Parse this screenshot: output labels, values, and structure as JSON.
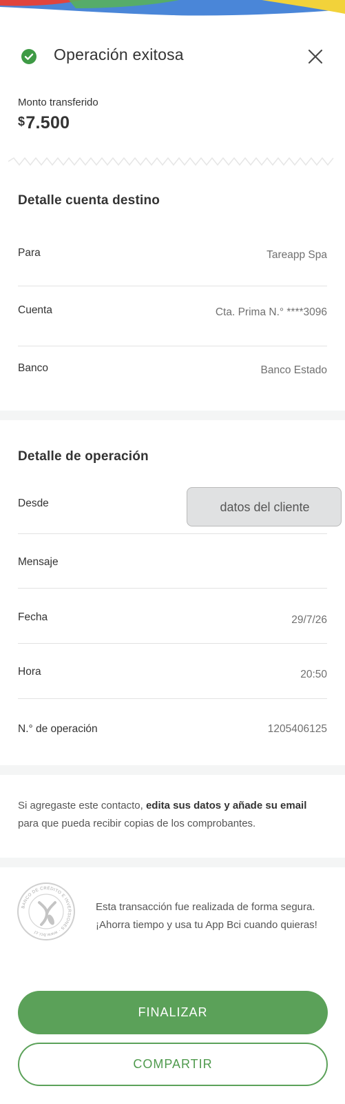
{
  "header": {
    "title": "Operación exitosa"
  },
  "amount": {
    "label": "Monto transferido",
    "currency_symbol": "$",
    "value": "7.500"
  },
  "destination": {
    "title": "Detalle cuenta destino",
    "rows": [
      {
        "label": "Para",
        "value": "Tareapp Spa"
      },
      {
        "label": "Cuenta",
        "value": "Cta. Prima N.° ****3096"
      },
      {
        "label": "Banco",
        "value": "Banco Estado"
      }
    ]
  },
  "operation": {
    "title": "Detalle de operación",
    "rows": [
      {
        "label": "Desde",
        "value": "datos del cliente"
      },
      {
        "label": "Mensaje",
        "value": ""
      },
      {
        "label": "Fecha",
        "value": "29/7/26"
      },
      {
        "label": "Hora",
        "value": "20:50"
      },
      {
        "label": "N.° de operación",
        "value": "1205406125"
      }
    ]
  },
  "note": {
    "part1": "Si agregaste este contacto, ",
    "bold": "edita sus datos y añade su email",
    "part2": " para que pueda recibir copias de los comprobantes."
  },
  "secure": {
    "text": "Esta transacción fue realizada de forma segura. ¡Ahorra tiempo y usa tu App Bci cuando quieras!",
    "seal_text": "BANCO DE CRÉDITO E INVERSIONES · www.bci.cl"
  },
  "buttons": {
    "finalize": "FINALIZAR",
    "share": "COMPARTIR"
  },
  "colors": {
    "accent_green": "#5ba159",
    "wave_blue": "#4a86d8",
    "wave_red": "#e0443e",
    "wave_yellow": "#f2d23a",
    "wave_green": "#58b05e"
  }
}
